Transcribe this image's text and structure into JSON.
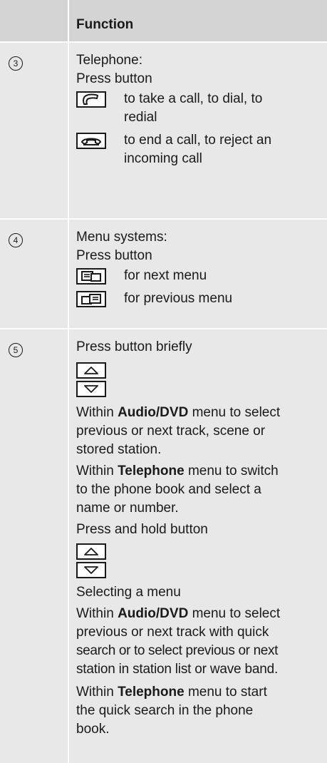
{
  "header": {
    "function_label": "Function"
  },
  "row3": {
    "number": "3",
    "title": "Telephone:",
    "press": "Press button",
    "call_line1": "to take a call, to dial, to",
    "call_line2": "redial",
    "end_line1": "to end a call, to reject an",
    "end_line2": "incoming call"
  },
  "row4": {
    "number": "4",
    "title": "Menu systems:",
    "press": "Press button",
    "next": "for next menu",
    "prev": "for previous menu"
  },
  "row5": {
    "number": "5",
    "press_briefly": "Press button briefly",
    "p1_l1_pre": "Within ",
    "p1_l1_bold": "Audio/DVD",
    "p1_l1_post": " menu to select",
    "p1_l2": "previous or next track, scene or",
    "p1_l3": "stored station.",
    "p2_l1_pre": "Within ",
    "p2_l1_bold": "Telephone",
    "p2_l1_post": " menu to switch",
    "p2_l2": "to the phone book and select a",
    "p2_l3": "name or number.",
    "press_hold": "Press and hold button",
    "selecting": "Selecting a menu",
    "p3_l1_pre": "Within ",
    "p3_l1_bold": "Audio/DVD",
    "p3_l1_post": " menu to select",
    "p3_l2": "previous or next track with quick",
    "p3_l3": "search or to select previous or next",
    "p3_l4": "station in station list or wave band.",
    "p4_l1_pre": "Within ",
    "p4_l1_bold": "Telephone",
    "p4_l1_post": " menu to start",
    "p4_l2": "the quick search in the phone",
    "p4_l3": "book."
  },
  "icons": {
    "call": "phone-pickup-icon",
    "end": "phone-hangup-icon",
    "next": "next-menu-icon",
    "prev": "previous-menu-icon",
    "up": "up-arrow-icon",
    "down": "down-arrow-icon"
  }
}
